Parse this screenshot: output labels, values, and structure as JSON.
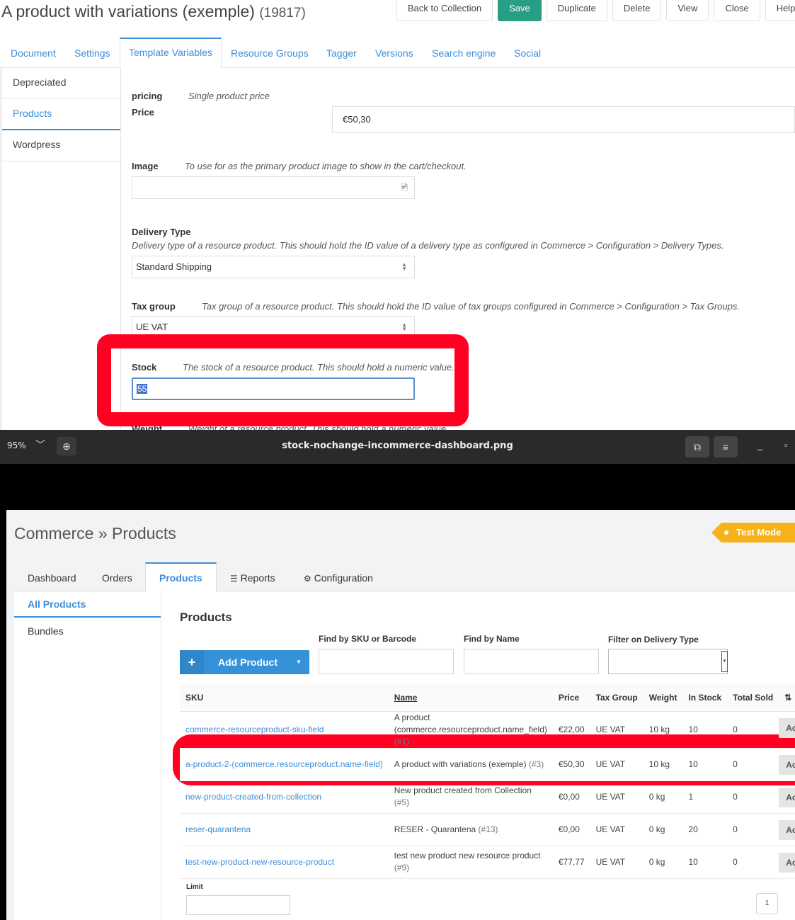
{
  "resource": {
    "title": "A product with variations (exemple)",
    "id": "(19817)",
    "toolbar": [
      "Back to Collection",
      "Save",
      "Duplicate",
      "Delete",
      "View",
      "Close",
      "Help"
    ],
    "tabs": [
      "Document",
      "Settings",
      "Template Variables",
      "Resource Groups",
      "Tagger",
      "Versions",
      "Search engine",
      "Social"
    ],
    "active_tab": "Template Variables",
    "side_tabs": [
      "Depreciated",
      "Products",
      "Wordpress"
    ],
    "active_side_tab": "Products",
    "fields": {
      "pricing_category": "pricing",
      "pricing_desc": "Single product price",
      "price_label": "Price",
      "price_value": "€50,30",
      "image_label": "Image",
      "image_desc": "To use for as the primary product image to show in the cart/checkout.",
      "delivery_label": "Delivery Type",
      "delivery_desc": "Delivery type of a resource product. This should hold the ID value of a delivery type as configured in Commerce > Configuration > Delivery Types.",
      "delivery_value": "Standard Shipping",
      "tax_label": "Tax group",
      "tax_desc": "Tax group of a resource product. This should hold the ID value of tax groups configured in Commerce > Configuration > Tax Groups.",
      "tax_value": "UE VAT",
      "stock_label": "Stock",
      "stock_desc": "The stock of a resource product. This should hold a numeric value.",
      "stock_value": "55",
      "weight_label": "Weight",
      "weight_desc": "Weight of a resource product. This should hold a numeric value."
    }
  },
  "viewer": {
    "zoom": "95%",
    "filename": "stock-nochange-incommerce-dashboard.png"
  },
  "commerce": {
    "breadcrumb": "Commerce » Products",
    "test_mode": "Test Mode",
    "tabs": [
      "Dashboard",
      "Orders",
      "Products",
      "Reports",
      "Configuration"
    ],
    "active_tab": "Products",
    "side": [
      "All Products",
      "Bundles"
    ],
    "heading": "Products",
    "add_button": "Add Product",
    "filters": {
      "sku": "Find by SKU or Barcode",
      "name": "Find by Name",
      "delivery": "Filter on Delivery Type"
    },
    "columns": [
      "SKU",
      "Name",
      "Price",
      "Tax Group",
      "Weight",
      "In Stock",
      "Total Sold"
    ],
    "actions_label": "Actions",
    "rows": [
      {
        "sku": "commerce-resourceproduct-sku-field",
        "name": "A product (commerce.resourceproduct.name_field)",
        "id": "(#1)",
        "price": "€22,00",
        "tax": "UE VAT",
        "weight": "10 kg",
        "stock": "10",
        "sold": "0"
      },
      {
        "sku": "a-product-2-(commerce.resourceproduct.name-field)",
        "name": "A product with variations (exemple)",
        "id": "(#3)",
        "price": "€50,30",
        "tax": "UE VAT",
        "weight": "10 kg",
        "stock": "10",
        "sold": "0"
      },
      {
        "sku": "new-product-created-from-collection",
        "name": "New product created from Collection",
        "id": "(#5)",
        "price": "€0,00",
        "tax": "UE VAT",
        "weight": "0 kg",
        "stock": "1",
        "sold": "0"
      },
      {
        "sku": "reser-quarantena",
        "name": "RESER - Quarantena",
        "id": "(#13)",
        "price": "€0,00",
        "tax": "UE VAT",
        "weight": "0 kg",
        "stock": "20",
        "sold": "0"
      },
      {
        "sku": "test-new-product-new-resource-product",
        "name": "test new product new resource product",
        "id": "(#9)",
        "price": "€77,77",
        "tax": "UE VAT",
        "weight": "0 kg",
        "stock": "10",
        "sold": "0"
      }
    ],
    "limit_label": "Limit",
    "page": "1"
  }
}
